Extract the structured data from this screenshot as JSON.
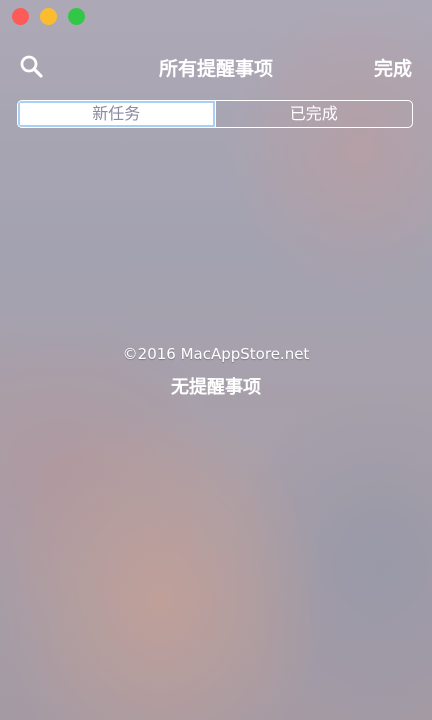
{
  "window": {
    "traffic_lights": [
      "close",
      "minimize",
      "zoom"
    ]
  },
  "toolbar": {
    "title": "所有提醒事项",
    "search_icon": "search-icon",
    "done_label": "完成"
  },
  "segments": [
    {
      "label": "新任务",
      "selected": true
    },
    {
      "label": "已完成",
      "selected": false
    }
  ],
  "content": {
    "watermark": "©2016 MacAppStore.net",
    "empty_label": "无提醒事项"
  },
  "colors": {
    "close": "#fc5b57",
    "minimize": "#fdbc2e",
    "zoom": "#33c748",
    "selected_segment_text": "#8a8aa0",
    "focus_ring": "#a9cff4"
  }
}
